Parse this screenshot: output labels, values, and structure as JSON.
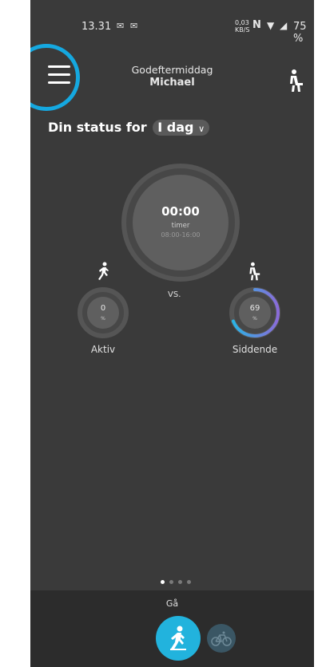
{
  "statusbar": {
    "time": "13.31",
    "data_rate": "0,03 KB/S",
    "nfc": "N",
    "battery": "75 %"
  },
  "header": {
    "greeting": "Godeftermiddag",
    "user_name": "Michael"
  },
  "status": {
    "prefix": "Din status for",
    "period": "I dag"
  },
  "timer": {
    "time": "00:00",
    "unit": "timer",
    "range": "08:00-16:00"
  },
  "comparison": {
    "vs": "VS.",
    "active": {
      "label": "Aktiv",
      "value": "0",
      "unit": "%",
      "fraction": 0
    },
    "sitting": {
      "label": "Siddende",
      "value": "69",
      "unit": "%",
      "fraction": 0.69
    }
  },
  "pager": {
    "count": 4,
    "active_index": 0
  },
  "mode": {
    "label": "Gå"
  },
  "colors": {
    "background": "#3a3a3a",
    "accent": "#22b3dd",
    "highlight_circle": "#15a8e0",
    "sitting_gradient_start": "#27b6e6",
    "sitting_gradient_end": "#8a6bd8"
  },
  "icons": {
    "menu": "hamburger-menu-icon",
    "person_top": "sitting-person-icon",
    "walk": "walking-person-icon",
    "sit": "sitting-person-icon",
    "mode_walk": "walking-person-icon",
    "mode_bike": "bicycle-icon"
  }
}
